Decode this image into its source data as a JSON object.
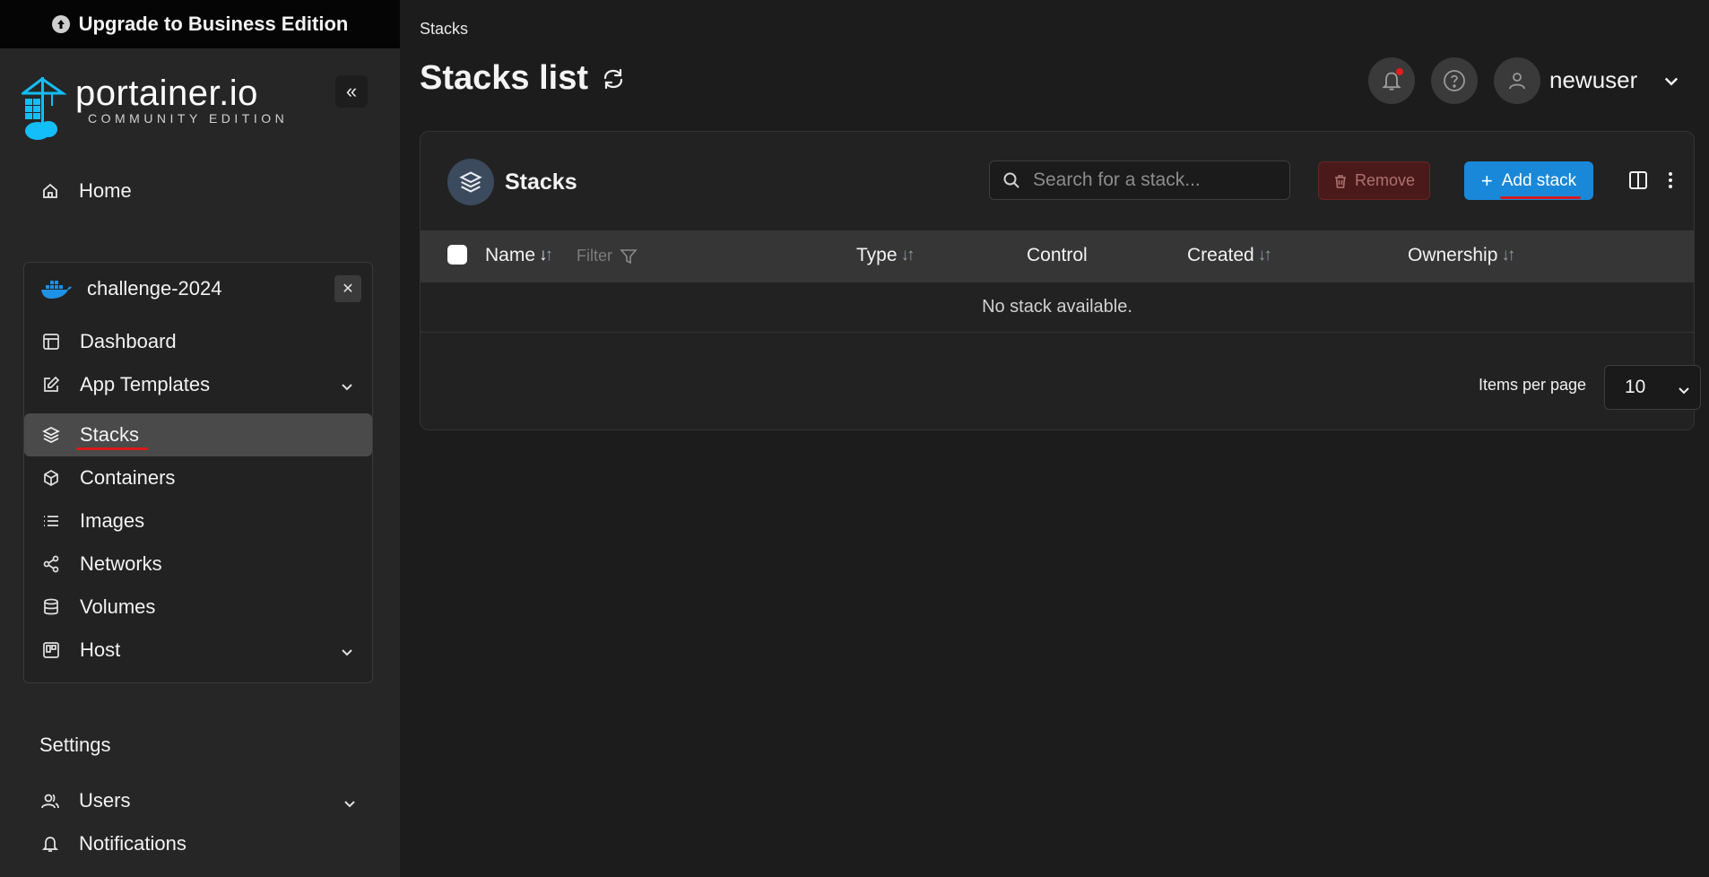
{
  "upgrade_bar": {
    "label": "Upgrade to Business Edition"
  },
  "logo": {
    "name": "portainer.io",
    "edition": "COMMUNITY EDITION"
  },
  "sidebar": {
    "home_label": "Home",
    "environment": {
      "name": "challenge-2024",
      "items": [
        {
          "label": "Dashboard",
          "icon": "dashboard-icon"
        },
        {
          "label": "App Templates",
          "icon": "edit-icon",
          "expandable": true
        },
        {
          "label": "Stacks",
          "icon": "layers-icon",
          "active": true
        },
        {
          "label": "Containers",
          "icon": "box-icon"
        },
        {
          "label": "Images",
          "icon": "list-icon"
        },
        {
          "label": "Networks",
          "icon": "share-icon"
        },
        {
          "label": "Volumes",
          "icon": "database-icon"
        },
        {
          "label": "Host",
          "icon": "host-icon",
          "expandable": true
        }
      ]
    },
    "settings_label": "Settings",
    "settings_items": [
      {
        "label": "Users",
        "icon": "users-icon",
        "expandable": true
      },
      {
        "label": "Notifications",
        "icon": "bell-icon"
      }
    ]
  },
  "header": {
    "breadcrumb": "Stacks",
    "title": "Stacks list",
    "username": "newuser"
  },
  "stacks_panel": {
    "title": "Stacks",
    "search_placeholder": "Search for a stack...",
    "remove_label": "Remove",
    "add_label": "Add stack",
    "columns": {
      "name": "Name",
      "filter": "Filter",
      "type": "Type",
      "control": "Control",
      "created": "Created",
      "ownership": "Ownership"
    },
    "empty_message": "No stack available.",
    "items_per_page_label": "Items per page",
    "items_per_page_value": "10"
  },
  "colors": {
    "accent": "#1a88d8",
    "danger": "#4a1a1a",
    "active_nav": "#4a4a4a"
  }
}
